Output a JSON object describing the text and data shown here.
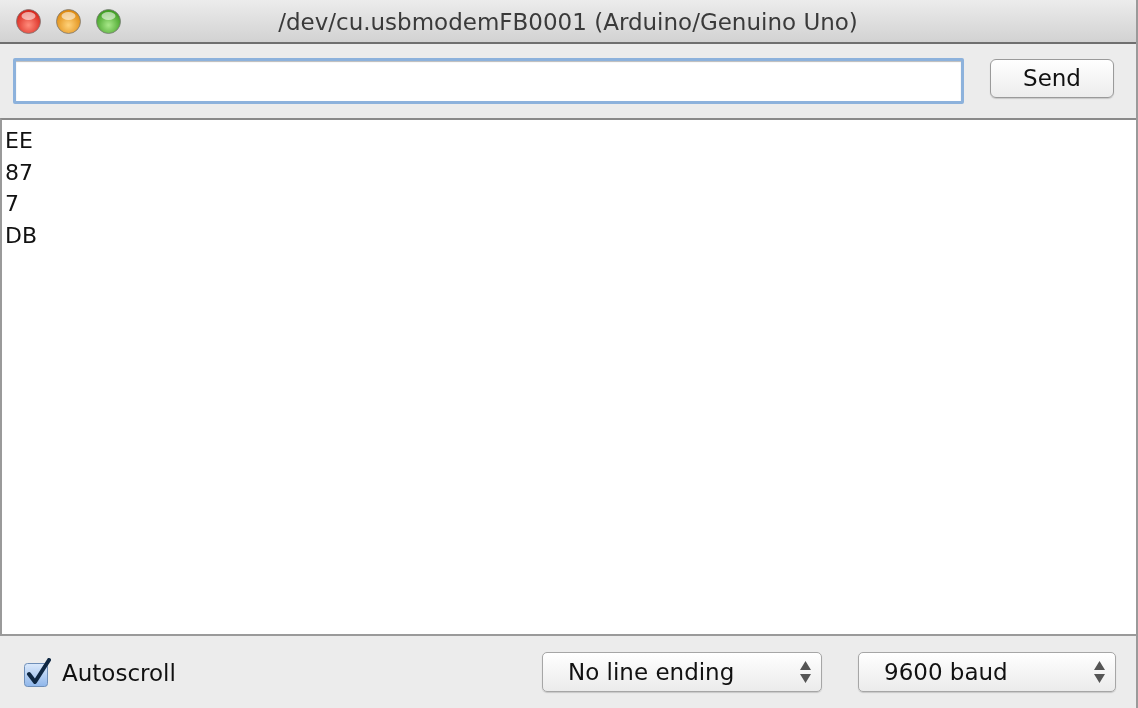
{
  "window": {
    "title": "/dev/cu.usbmodemFB0001 (Arduino/Genuino Uno)"
  },
  "send_button": {
    "label": "Send"
  },
  "output": {
    "lines": [
      "EE",
      "87",
      "7",
      "DB"
    ]
  },
  "autoscroll": {
    "label": "Autoscroll",
    "checked": true
  },
  "line_ending": {
    "value": "No line ending"
  },
  "baud_rate": {
    "value": "9600 baud"
  }
}
